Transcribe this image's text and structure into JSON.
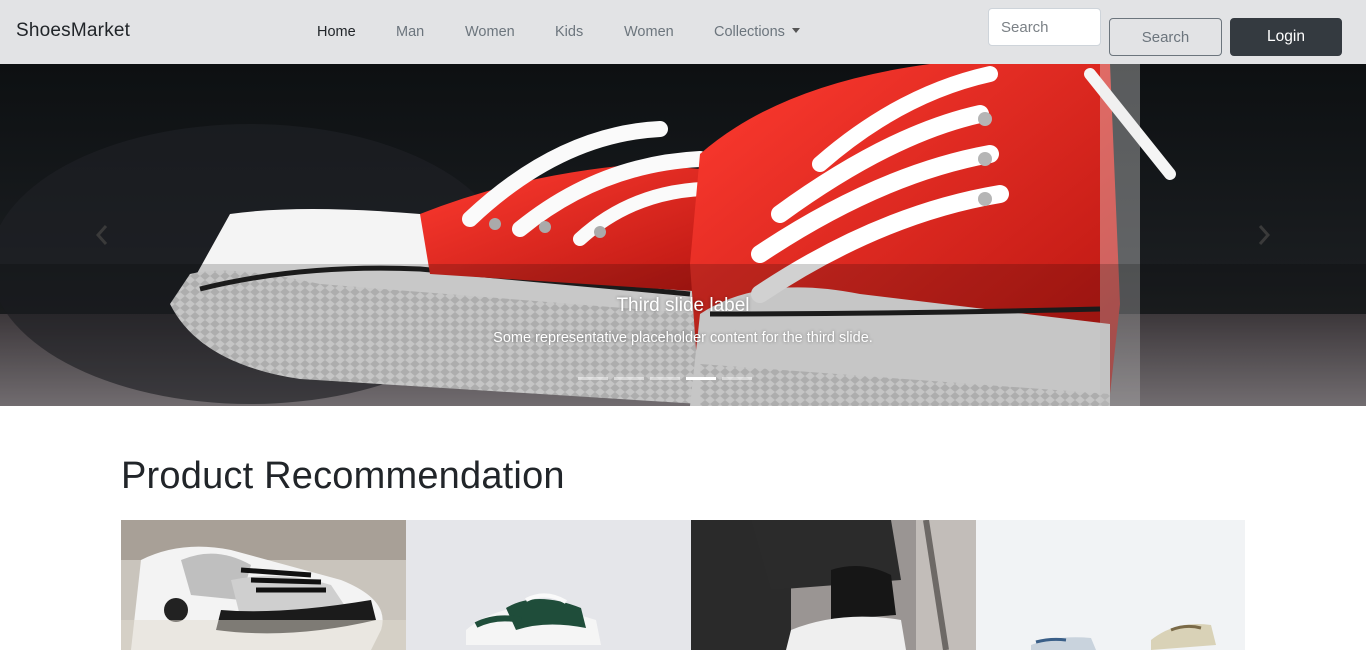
{
  "brand": "ShoesMarket",
  "nav": {
    "items": [
      {
        "label": "Home",
        "active": true
      },
      {
        "label": "Man",
        "active": false
      },
      {
        "label": "Women",
        "active": false
      },
      {
        "label": "Kids",
        "active": false
      },
      {
        "label": "Women",
        "active": false
      },
      {
        "label": "Collections",
        "active": false,
        "dropdown": true
      }
    ]
  },
  "search": {
    "placeholder": "Search",
    "value": "",
    "button_label": "Search"
  },
  "login_label": "Login",
  "carousel": {
    "caption_title": "Third slide label",
    "caption_text": "Some representative placeholder content for the third slide.",
    "slide_count": 5,
    "active_index": 3,
    "prev_icon": "chevron-left-icon",
    "next_icon": "chevron-right-icon"
  },
  "recommendation": {
    "title": "Product Recommendation",
    "products": [
      {
        "name": "grey-white-high-top-sneaker"
      },
      {
        "name": "green-white-low-sneaker"
      },
      {
        "name": "white-sneaker-dark-pants"
      },
      {
        "name": "canvas-sneakers-white"
      }
    ]
  },
  "colors": {
    "navbar_bg": "#e2e3e5",
    "login_bg": "#343a40",
    "sneaker_red": "#e3241f"
  }
}
